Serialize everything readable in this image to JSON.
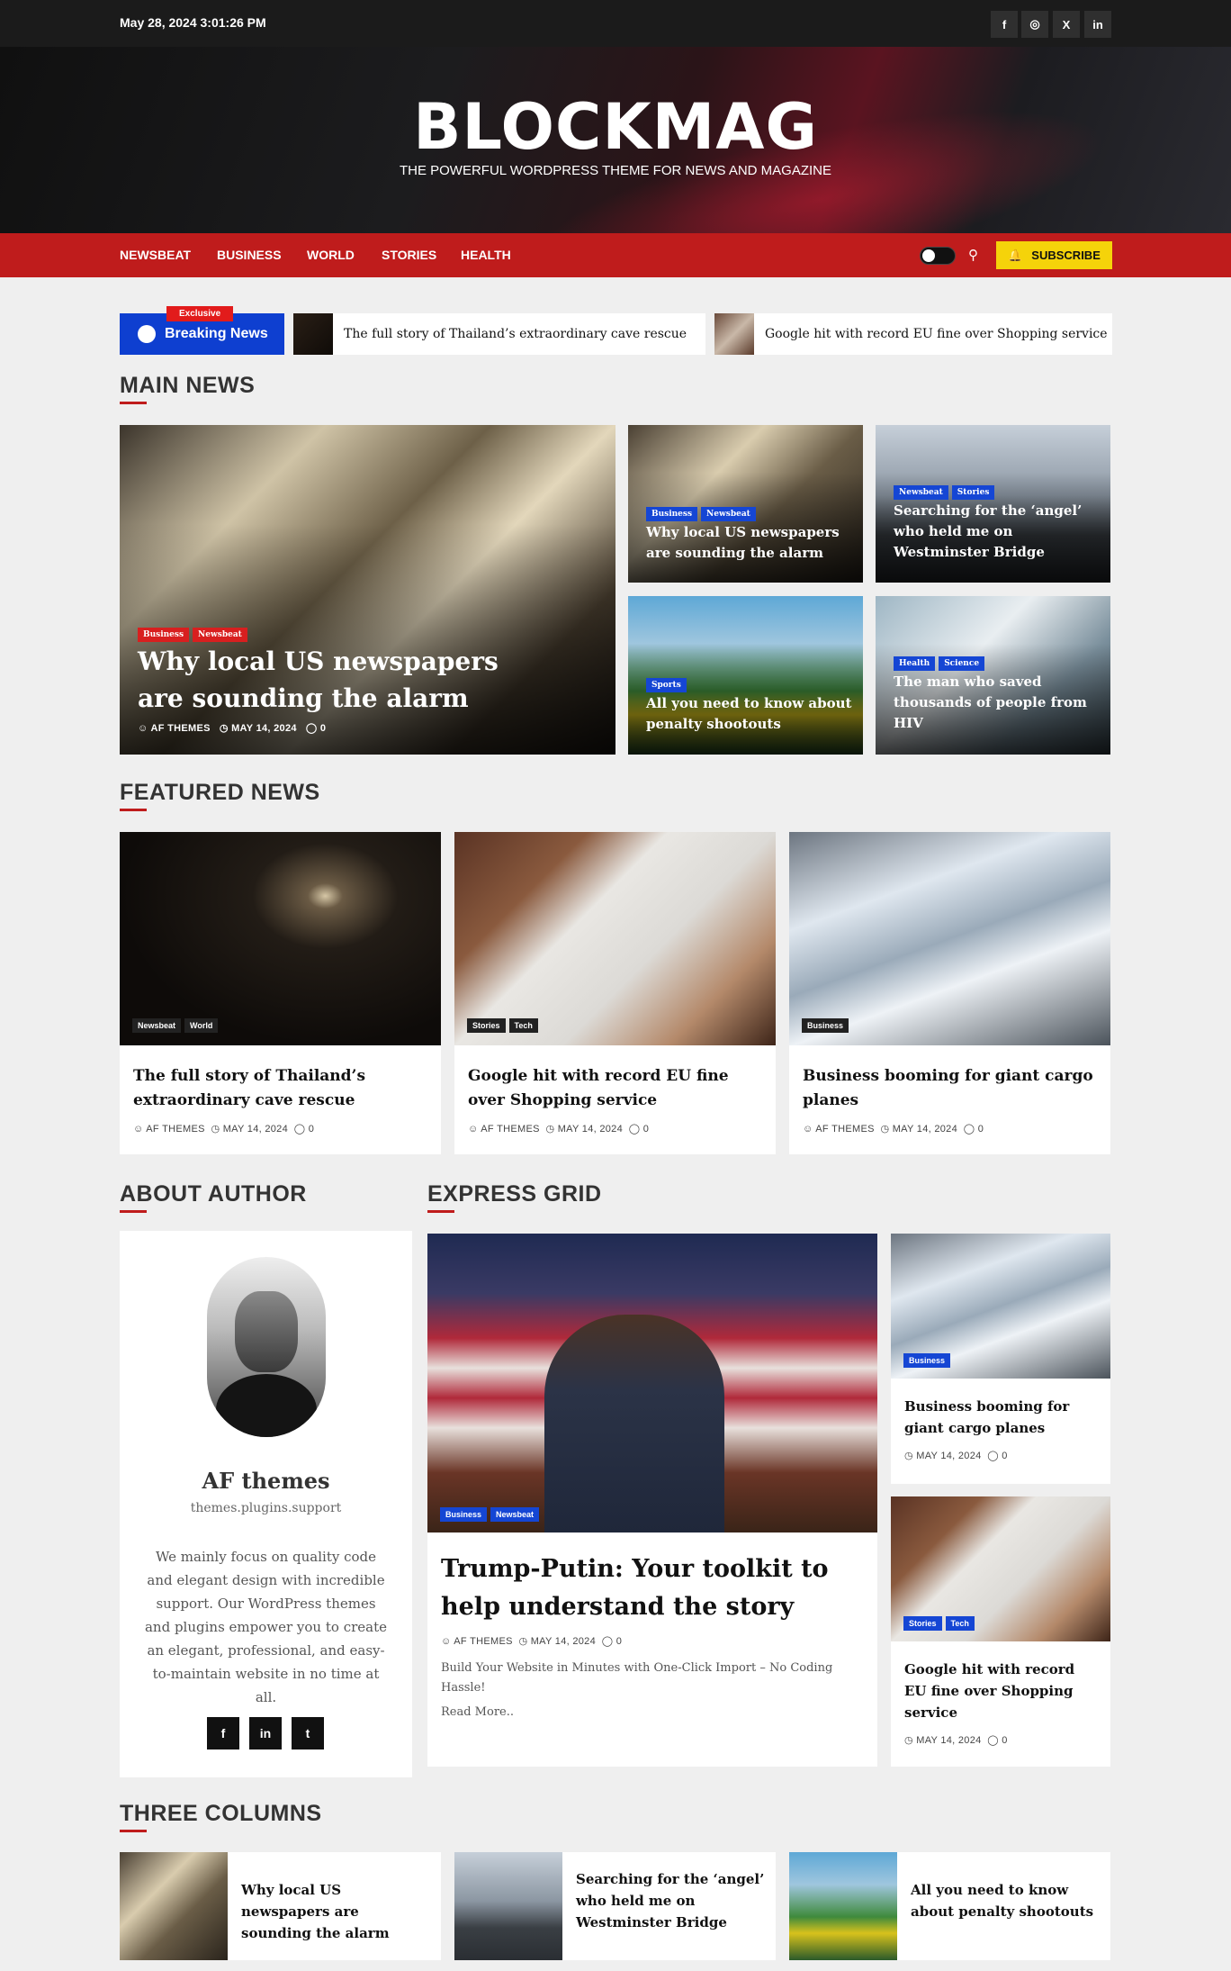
{
  "topbar": {
    "date": "May 28, 2024 3:01:26 PM",
    "socials": [
      "f",
      "◎",
      "X",
      "in"
    ]
  },
  "site": {
    "title": "BLOCKMAG",
    "tagline": "THE POWERFUL WORDPRESS THEME FOR NEWS AND MAGAZINE"
  },
  "nav": {
    "items": [
      "NEWSBEAT",
      "BUSINESS",
      "WORLD",
      "STORIES",
      "HEALTH"
    ],
    "subscribe": "SUBSCRIBE"
  },
  "ticker": {
    "exclusive": "Exclusive",
    "label": "Breaking News",
    "items": [
      "The full story of Thailand’s extraordinary cave rescue",
      "Google hit with record EU fine over Shopping service"
    ]
  },
  "main_news": {
    "section_title": "MAIN NEWS",
    "lead": {
      "tags": [
        "Business",
        "Newsbeat"
      ],
      "title": "Why local US newspapers are sounding the alarm",
      "author": "AF THEMES",
      "date": "MAY 14, 2024",
      "comments": "0"
    },
    "side": [
      {
        "tags": [
          "Business",
          "Newsbeat"
        ],
        "title": "Why local US newspapers are sounding the alarm"
      },
      {
        "tags": [
          "Newsbeat",
          "Stories"
        ],
        "title": "Searching for the ‘angel’ who held me on Westminster Bridge"
      },
      {
        "tags": [
          "Sports"
        ],
        "title": "All you need to know about penalty shootouts"
      },
      {
        "tags": [
          "Health",
          "Science"
        ],
        "title": "The man who saved thousands of people from HIV"
      }
    ]
  },
  "featured_news": {
    "section_title": "FEATURED NEWS",
    "items": [
      {
        "tags": [
          "Newsbeat",
          "World"
        ],
        "title": "The full story of Thailand’s extraordinary cave rescue",
        "author": "AF THEMES",
        "date": "MAY 14, 2024",
        "comments": "0"
      },
      {
        "tags": [
          "Stories",
          "Tech"
        ],
        "title": "Google hit with record EU fine over Shopping service",
        "author": "AF THEMES",
        "date": "MAY 14, 2024",
        "comments": "0"
      },
      {
        "tags": [
          "Business"
        ],
        "title": "Business booming for giant cargo planes",
        "author": "AF THEMES",
        "date": "MAY 14, 2024",
        "comments": "0"
      }
    ]
  },
  "about_author": {
    "section_title": "ABOUT AUTHOR",
    "name": "AF themes",
    "subtitle": "themes.plugins.support",
    "bio": "We mainly focus on quality code and elegant design with incredible support. Our WordPress themes and plugins empower you to create an elegant, professional, and easy-to-maintain website in no time at all.",
    "socials": [
      "f",
      "in",
      "t"
    ]
  },
  "express_grid": {
    "section_title": "EXPRESS GRID",
    "lead": {
      "tags": [
        "Business",
        "Newsbeat"
      ],
      "title": "Trump-Putin: Your toolkit to help understand the story",
      "author": "AF THEMES",
      "date": "MAY 14, 2024",
      "comments": "0",
      "excerpt": "Build Your Website in Minutes with One-Click Import – No Coding Hassle!",
      "read_more": "Read More.."
    },
    "side": [
      {
        "tags": [
          "Business"
        ],
        "title": "Business booming for giant cargo planes",
        "date": "MAY 14, 2024",
        "comments": "0"
      },
      {
        "tags": [
          "Stories",
          "Tech"
        ],
        "title": "Google hit with record EU fine over Shopping service",
        "date": "MAY 14, 2024",
        "comments": "0"
      }
    ]
  },
  "three_columns": {
    "section_title": "THREE COLUMNS",
    "items": [
      {
        "title": "Why local US newspapers are sounding the alarm"
      },
      {
        "title": "Searching for the ‘angel’ who held me on Westminster Bridge"
      },
      {
        "title": "All you need to know about penalty shootouts"
      }
    ]
  },
  "colors": {
    "brand_red": "#bf1c1c",
    "topbar": "#1b1b1b",
    "subscribe_yellow": "#f5d30a",
    "breaking_blue": "#0e3fd0",
    "tag_red": "#d81f1f",
    "tag_blue": "#1546d4"
  },
  "icons": [
    "facebook-icon",
    "instagram-icon",
    "x-icon",
    "linkedin-icon",
    "search-icon",
    "bell-icon",
    "user-icon",
    "clock-icon",
    "comment-icon",
    "twitter-icon"
  ]
}
